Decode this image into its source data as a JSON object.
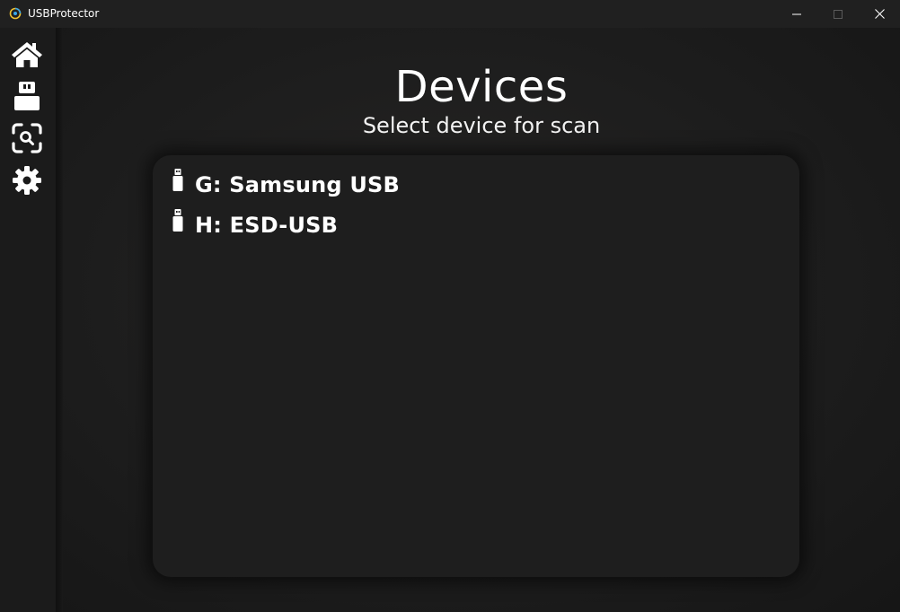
{
  "window": {
    "title": "USBProtector"
  },
  "window_controls": {
    "minimize_icon": "minimize-icon",
    "maximize_icon": "maximize-icon",
    "close_icon": "close-icon"
  },
  "sidebar": {
    "items": [
      {
        "icon": "home-icon"
      },
      {
        "icon": "usb-drive-icon"
      },
      {
        "icon": "scan-search-icon"
      },
      {
        "icon": "gear-icon"
      }
    ]
  },
  "main": {
    "title": "Devices",
    "subtitle": "Select device for scan"
  },
  "devices": [
    {
      "label": "G: Samsung USB",
      "icon": "usb-stick-icon"
    },
    {
      "label": "H: ESD-USB",
      "icon": "usb-stick-icon"
    }
  ],
  "colors": {
    "background": "#1c1c1c",
    "text": "#ffffff"
  }
}
